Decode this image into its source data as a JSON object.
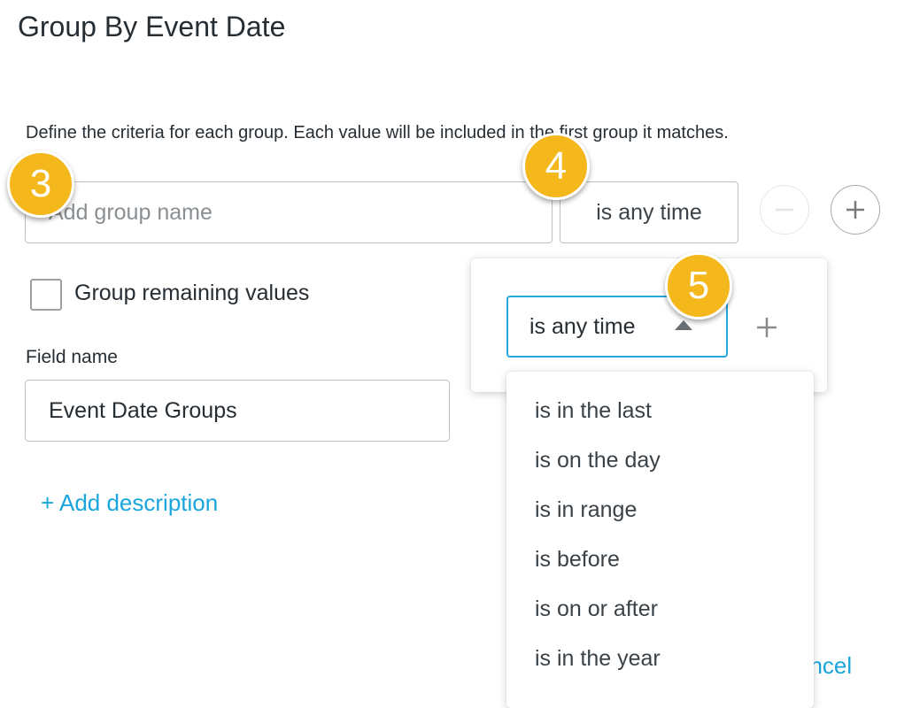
{
  "dialog": {
    "title": "Group By Event Date",
    "description": "Define the criteria for each group. Each value will be included in the first group it matches."
  },
  "group_row": {
    "name_placeholder": "Add group name",
    "name_value": "",
    "condition_label": "is any time",
    "remove_icon": "minus-circle-icon",
    "add_icon": "plus-circle-icon"
  },
  "group_remaining": {
    "label": "Group remaining values",
    "checked": false
  },
  "field_name": {
    "label": "Field name",
    "value": "Event Date Groups"
  },
  "add_description_label": "+ Add description",
  "cancel_label": "ancel",
  "condition_popover": {
    "selected": "is any time",
    "caret_icon": "caret-up-icon",
    "add_icon": "plus-icon",
    "options": [
      "is in the last",
      "is on the day",
      "is in range",
      "is before",
      "is on or after",
      "is in the year"
    ]
  },
  "callouts": {
    "step3": "3",
    "step4": "4",
    "step5": "5"
  },
  "colors": {
    "accent": "#1aa5dd",
    "focus_border": "#25a9dc",
    "callout": "#f4b81c",
    "text": "#262d33"
  }
}
